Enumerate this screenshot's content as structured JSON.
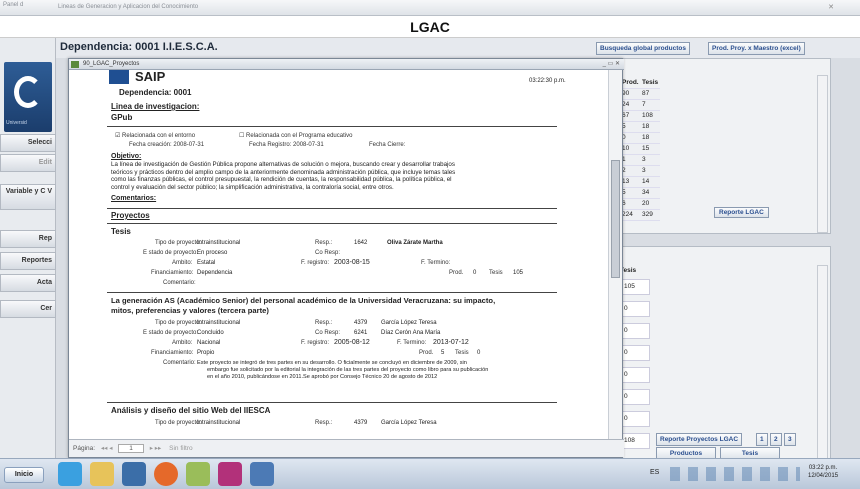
{
  "app": {
    "panel_tab": "Panel d",
    "title": "Lineas de Generacion y Aplicacion del Conocimiento",
    "header": "LGAC"
  },
  "nav": {
    "logo_label": "Universid",
    "items": [
      "Selecci",
      "Edit",
      "Variable y C V",
      "Rep",
      "Reportes",
      "Acta",
      "Cer"
    ]
  },
  "dep": {
    "title": "Dependencia:  0001  I.I.E.S.C.A.",
    "btn_global": "Busqueda global productos",
    "btn_maestro": "Prod. Proy. x Maestro (excel)"
  },
  "right_top": {
    "headers": [
      "Prod.",
      "Tesis"
    ],
    "rows": [
      [
        "90",
        "87"
      ],
      [
        "24",
        "7"
      ],
      [
        "67",
        "108"
      ],
      [
        "5",
        "18"
      ],
      [
        "0",
        "18"
      ],
      [
        "10",
        "15"
      ],
      [
        "1",
        "3"
      ],
      [
        "2",
        "3"
      ],
      [
        "13",
        "14"
      ],
      [
        "5",
        "34"
      ],
      [
        "6",
        "20"
      ],
      [
        "224",
        "329"
      ]
    ],
    "button": "Reporte LGAC"
  },
  "right_bottom": {
    "header": "Tesis",
    "values": [
      "105",
      "0",
      "0",
      "0",
      "0",
      "0",
      "0",
      "108"
    ],
    "btn_proyectos": "Reporte Proyectos LGAC",
    "pages": [
      "1",
      "2",
      "3"
    ],
    "tab_productos": "Productos",
    "tab_tesis": "Tesis"
  },
  "report": {
    "window_title": "90_LGAC_Proyectos",
    "saip": "SAIP",
    "time": "03:22:30 p.m.",
    "dependencia": "Dependencia: 0001",
    "linea_label": "Linea de investigacion:",
    "linea_value": "GPub",
    "chk1": "Relacionada con el entorno",
    "chk2": "Relacionada con el Programa educativo",
    "fecha_creacion": "Fecha creación: 2008-07-31",
    "fecha_registro": "Fecha Registro: 2008-07-31",
    "fecha_cierre": "Fecha Cierre:",
    "objetivo_label": "Objetivo:",
    "objetivo_text": [
      "La línea de investigación de Gestión Pública propone alternativas de solución o mejora, buscando crear y desarrollar trabajos",
      "teóricos y prácticos dentro del amplio campo de la anteriormente denominada administración pública, que incluye temas tales",
      "como las finanzas públicas, el control presupuestal, la rendición de cuentas, la responsabilidad pública, la política pública, el",
      "control y evaluación del sector público; la simplificación administrativa, la contraloría social, entre otros."
    ],
    "comentarios_label": "Comentarios:",
    "proyectos_label": "Proyectos",
    "p1": {
      "title": "Tesis",
      "tipo": "Intrainstitucional",
      "estado": "En proceso",
      "ambito": "Estatal",
      "financiamiento": "Dependencia",
      "resp_num": "1642",
      "resp_name": "Oliva Zárate Martha",
      "registro": "2003-08-15",
      "prod": "0",
      "tesis": "105"
    },
    "p2": {
      "title": [
        "La generación AS (Académico Senior) del personal académico de la Universidad Veracruzana: su impacto,",
        "mitos, preferencias y valores (tercera parte)"
      ],
      "tipo": "Intrainstitucional",
      "estado": "Concluido",
      "ambito": "Nacional",
      "financiamiento": "Propio",
      "resp_num": "4379",
      "resp_name": "García López Teresa",
      "coresp_num": "6241",
      "coresp_name": "Díaz Cerón Ana María",
      "registro": "2005-08-12",
      "termino": "2013-07-12",
      "prod": "5",
      "tesis": "0",
      "comentario": [
        "Este proyecto se integró de tres partes en su desarrollo. O ficialmente se concluyó en diciembre de 2009, sin",
        "embargo fue solicitado por la editorial la integración de las tres partes del proyecto como libro para su publicación",
        "en el año 2010, publicándose en 2011.Se aprobó  por Consejo Técnico 20 de agosto de 2012"
      ]
    },
    "p3": {
      "title": "Análisis y diseño del sitio Web del IIESCA",
      "tipo": "Intrainstitucional",
      "resp_num": "4379",
      "resp_name": "García López Teresa"
    },
    "labels": {
      "tipo": "Tipo de proyecto:",
      "estado": "E stado de proyecto:",
      "ambito": "Ambito:",
      "financiamiento": "Financiamiento:",
      "comentario": "Comentario:",
      "resp": "Resp.:",
      "coresp": "Co Resp:",
      "registro": "F. registro:",
      "termino": "F. Termino:",
      "prod": "Prod.",
      "tesis": "Tesis"
    },
    "footer_pagina": "Página:",
    "footer_page": "1",
    "footer_filter": "Sin filtro"
  },
  "taskbar": {
    "start": "Inicio",
    "lang": "ES",
    "clock_time": "03:22 p.m.",
    "clock_date": "12/04/2015"
  }
}
